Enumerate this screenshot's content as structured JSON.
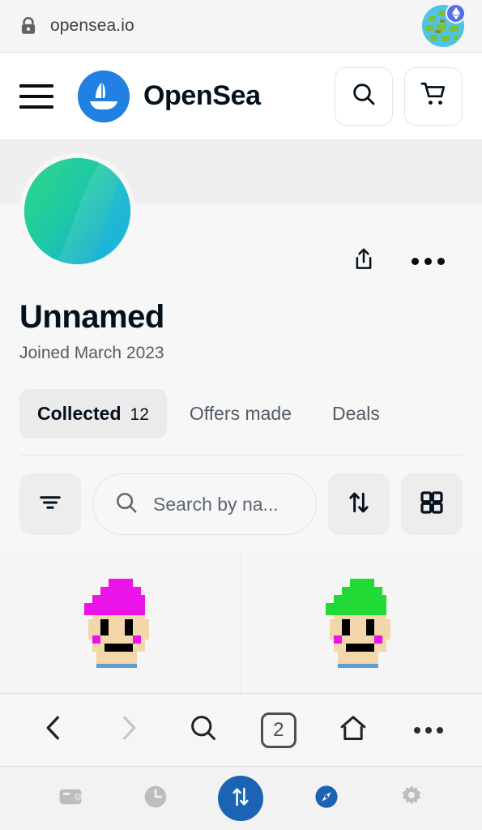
{
  "browser": {
    "url": "opensea.io",
    "lock_icon": "lock-icon",
    "favicon": "globe-icon",
    "favicon_badge": "ethereum-icon",
    "nav": {
      "back": "back-icon",
      "forward": "forward-icon",
      "search": "search-icon",
      "tab_count": "2",
      "home": "home-icon",
      "more": "more-icon"
    }
  },
  "site_header": {
    "menu_icon": "hamburger-icon",
    "logo_icon": "opensea-ship-icon",
    "brand": "OpenSea",
    "search_icon": "search-icon",
    "cart_icon": "cart-icon",
    "brand_color": "#2081e2"
  },
  "profile": {
    "avatar": "profile-avatar",
    "share_icon": "share-icon",
    "more_icon": "more-icon",
    "name": "Unnamed",
    "joined": "Joined March 2023",
    "avatar_colors": [
      "#26d08c",
      "#1ec6a8",
      "#17b5cf",
      "#12b6e0"
    ]
  },
  "tabs": [
    {
      "label": "Collected",
      "count": "12",
      "active": true
    },
    {
      "label": "Offers made",
      "count": "",
      "active": false
    },
    {
      "label": "Deals",
      "count": "",
      "active": false
    }
  ],
  "toolbar": {
    "filter_icon": "filter-icon",
    "search_icon": "search-icon",
    "search_placeholder": "Search by na...",
    "search_value": "",
    "sort_icon": "sort-arrows-icon",
    "view_icon": "grid-view-icon"
  },
  "items": [
    {
      "name": "pixel-punk-magenta-hat",
      "hat_color": "#ec13e8",
      "skin_color": "#f3d6aa",
      "eye_color": "#000000",
      "earring_color": "#ec13e8",
      "collar_color": "#5f9ed4"
    },
    {
      "name": "pixel-punk-green-hat",
      "hat_color": "#21da35",
      "skin_color": "#f3d6aa",
      "eye_color": "#000000",
      "earring_color": "#ec13e8",
      "collar_color": "#5f9ed4"
    }
  ],
  "dock": [
    {
      "name": "wallet-icon",
      "active": false
    },
    {
      "name": "history-clock-icon",
      "active": false
    },
    {
      "name": "swap-arrows-icon",
      "active": true
    },
    {
      "name": "compass-icon",
      "active": true
    },
    {
      "name": "settings-gear-icon",
      "active": false
    }
  ]
}
